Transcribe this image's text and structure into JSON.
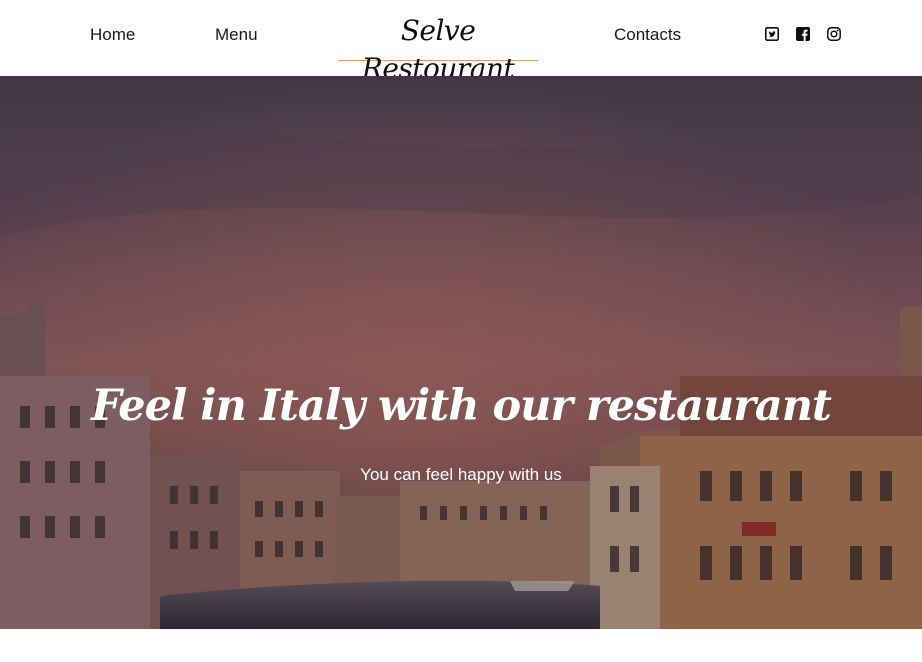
{
  "nav": {
    "home_label": "Home",
    "menu_label": "Menu",
    "contacts_label": "Contacts"
  },
  "brand": {
    "name": "Selve Restourant"
  },
  "social": [
    "twitter-icon",
    "facebook-icon",
    "instagram-icon"
  ],
  "hero": {
    "title": "Feel in Italy with our restaurant",
    "subtitle": "You can feel happy with us"
  },
  "colors": {
    "brand_underline": "#d6a067",
    "nav_text": "#1a1a1a",
    "hero_text": "#ffffff"
  }
}
